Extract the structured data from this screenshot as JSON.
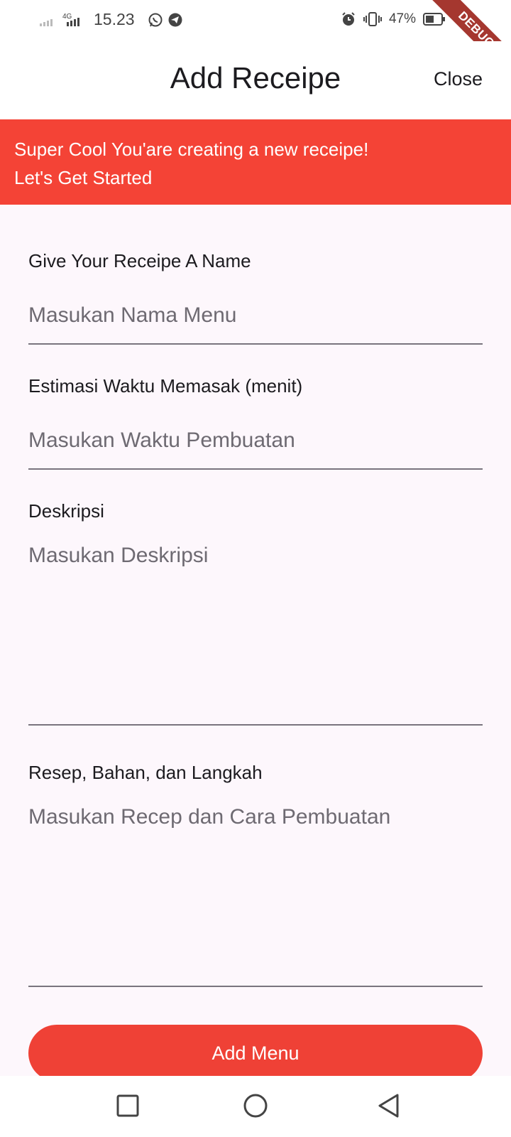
{
  "status_bar": {
    "time": "15.23",
    "network": "4G",
    "battery": "47%",
    "debug_label": "DEBUG"
  },
  "app_bar": {
    "title": "Add Receipe",
    "close_label": "Close"
  },
  "banner": {
    "line1": "Super Cool You'are creating a new receipe!",
    "line2": "Let's Get Started",
    "color": "#f44336"
  },
  "form": {
    "name": {
      "label": "Give Your Receipe A Name",
      "placeholder": "Masukan Nama Menu",
      "value": ""
    },
    "time": {
      "label": "Estimasi Waktu Memasak (menit)",
      "placeholder": "Masukan Waktu Pembuatan",
      "value": ""
    },
    "description": {
      "label": "Deskripsi",
      "placeholder": "Masukan Deskripsi",
      "value": ""
    },
    "recipe": {
      "label": "Resep, Bahan, dan Langkah",
      "placeholder": "Masukan Recep dan Cara Pembuatan",
      "value": ""
    }
  },
  "submit": {
    "label": "Add Menu",
    "color": "#ef4136"
  },
  "icons": [
    "signal-icon",
    "whatsapp-icon",
    "telegram-icon",
    "alarm-icon",
    "vibrate-icon",
    "battery-icon",
    "recents-icon",
    "home-icon",
    "back-icon"
  ]
}
